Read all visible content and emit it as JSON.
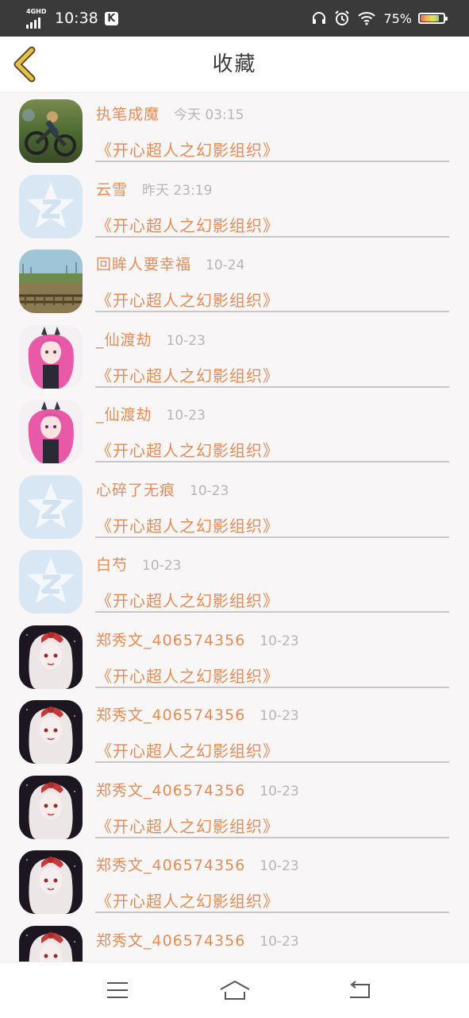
{
  "status_bar": {
    "network": "4GHD",
    "time": "10:38",
    "app_badge": "K",
    "battery_percent": "75%",
    "icons": [
      "signal-icon",
      "headphones-icon",
      "alarm-icon",
      "wifi-icon",
      "battery-icon"
    ]
  },
  "header": {
    "back_icon": "chevron-left-icon",
    "title": "收藏"
  },
  "favorites": [
    {
      "name": "执笔成魔",
      "date": "今天 03:15",
      "title": "《开心超人之幻影组织》",
      "avatar": "motorbike-photo"
    },
    {
      "name": "云雪",
      "date": "昨天 23:19",
      "title": "《开心超人之幻影组织》",
      "avatar": "qq-default-avatar"
    },
    {
      "name": "回眸人要幸福",
      "date": "10-24",
      "title": "《开心超人之幻影组织》",
      "avatar": "railway-landscape-photo"
    },
    {
      "name": "_仙渡劫",
      "date": "10-23",
      "title": "《开心超人之幻影组织》",
      "avatar": "pink-hair-anime-girl"
    },
    {
      "name": "_仙渡劫",
      "date": "10-23",
      "title": "《开心超人之幻影组织》",
      "avatar": "pink-hair-anime-girl"
    },
    {
      "name": "心碎了无痕",
      "date": "10-23",
      "title": "《开心超人之幻影组织》",
      "avatar": "qq-default-avatar"
    },
    {
      "name": "白芍",
      "date": "10-23",
      "title": "《开心超人之幻影组织》",
      "avatar": "qq-default-avatar"
    },
    {
      "name": "郑秀文_406574356",
      "date": "10-23",
      "title": "《开心超人之幻影组织》",
      "avatar": "white-hair-anime-girl"
    },
    {
      "name": "郑秀文_406574356",
      "date": "10-23",
      "title": "《开心超人之幻影组织》",
      "avatar": "white-hair-anime-girl"
    },
    {
      "name": "郑秀文_406574356",
      "date": "10-23",
      "title": "《开心超人之幻影组织》",
      "avatar": "white-hair-anime-girl"
    },
    {
      "name": "郑秀文_406574356",
      "date": "10-23",
      "title": "《开心超人之幻影组织》",
      "avatar": "white-hair-anime-girl"
    },
    {
      "name": "郑秀文_406574356",
      "date": "10-23",
      "title": "",
      "avatar": "white-hair-anime-girl"
    }
  ],
  "bottom_nav": {
    "icons": [
      "menu-icon",
      "home-icon",
      "back-icon"
    ]
  },
  "colors": {
    "accent": "#e58c57",
    "date_gray": "#b9b5b6",
    "status_bar_bg": "#3a3a3a",
    "list_bg": "#f8f6f7",
    "back_chevron": "#e6c247"
  }
}
